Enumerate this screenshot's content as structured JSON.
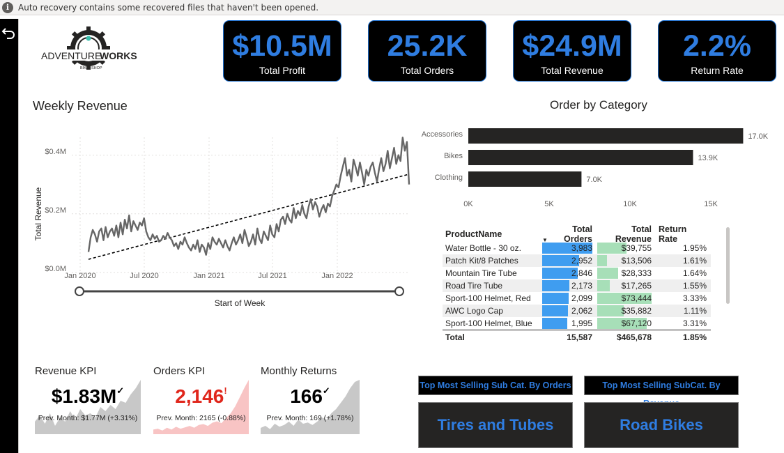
{
  "notice": "Auto recovery contains some recovered files that haven't been opened.",
  "logo": {
    "brand_a": "ADVENTURE",
    "brand_b": "WORKS",
    "ribbon_a": "BIKE",
    "ribbon_b": "SHOP"
  },
  "kpis": [
    {
      "value": "$10.5M",
      "label": "Total Profit"
    },
    {
      "value": "25.2K",
      "label": "Total Orders"
    },
    {
      "value": "$24.9M",
      "label": "Total Revenue"
    },
    {
      "value": "2.2%",
      "label": "Return Rate"
    }
  ],
  "weekly": {
    "title": "Weekly Revenue",
    "ylabel": "Total Revenue",
    "xlabel": "Start of Week",
    "yticks": [
      "$0.4M",
      "$0.2M",
      "$0.0M"
    ],
    "xticks": [
      "Jan 2020",
      "Jul 2020",
      "Jan 2021",
      "Jul 2021",
      "Jan 2022"
    ]
  },
  "category": {
    "title": "Order by Category",
    "xticks": [
      "0K",
      "5K",
      "10K",
      "15K"
    ]
  },
  "table": {
    "headers": [
      "ProductName",
      "Total Orders",
      "Total Revenue",
      "Return Rate"
    ],
    "rows": [
      {
        "name": "Water Bottle - 30 oz.",
        "orders": "3,983",
        "revenue": "$39,755",
        "rate": "1.95%"
      },
      {
        "name": "Patch Kit/8 Patches",
        "orders": "2,952",
        "revenue": "$13,506",
        "rate": "1.61%"
      },
      {
        "name": "Mountain Tire Tube",
        "orders": "2,846",
        "revenue": "$28,333",
        "rate": "1.64%"
      },
      {
        "name": "Road Tire Tube",
        "orders": "2,173",
        "revenue": "$17,265",
        "rate": "1.55%"
      },
      {
        "name": "Sport-100 Helmet, Red",
        "orders": "2,099",
        "revenue": "$73,444",
        "rate": "3.33%"
      },
      {
        "name": "AWC Logo Cap",
        "orders": "2,062",
        "revenue": "$35,882",
        "rate": "1.11%"
      },
      {
        "name": "Sport-100 Helmet, Blue",
        "orders": "1,995",
        "revenue": "$67,120",
        "rate": "3.31%"
      }
    ],
    "total": {
      "label": "Total",
      "orders": "15,587",
      "revenue": "$465,678",
      "rate": "1.85%"
    }
  },
  "mini_kpis": [
    {
      "title": "Revenue KPI",
      "value": "$1.83M",
      "mark": "✓",
      "sub": "Prev. Month: $1.77M (+3.31%)",
      "value_color": "#000000"
    },
    {
      "title": "Orders KPI",
      "value": "2,146",
      "mark": "!",
      "sub": "Prev. Month: 2165 (-0.88%)",
      "value_color": "#e0261b"
    },
    {
      "title": "Monthly Returns",
      "value": "166",
      "mark": "✓",
      "sub": "Prev. Month: 169 (+1.78%)",
      "value_color": "#000000"
    }
  ],
  "buttons": {
    "top_orders": "Top Most Selling Sub Cat. By Orders",
    "top_revenue": "Top Most Selling SubCat. By Revenue",
    "top_orders_value": "Tires and Tubes",
    "top_revenue_value": "Road Bikes"
  },
  "chart_data": [
    {
      "type": "line",
      "title": "Weekly Revenue",
      "xlabel": "Start of Week",
      "ylabel": "Total Revenue",
      "x_range": [
        "2020-01-01",
        "2022-06-30"
      ],
      "ylim": [
        0,
        450000
      ],
      "x_ticks": [
        "Jan 2020",
        "Jul 2020",
        "Jan 2021",
        "Jul 2021",
        "Jan 2022"
      ],
      "trend_line": {
        "start": 45000,
        "end": 335000
      },
      "series": [
        {
          "values": [
            70000,
            120000,
            145000,
            130000,
            105000,
            140000,
            150000,
            110000,
            155000,
            120000,
            140000,
            150000,
            125000,
            160000,
            120000,
            170000,
            130000,
            180000,
            150000,
            195000,
            140000,
            175000,
            160000,
            145000,
            170000,
            160000,
            185000,
            140000,
            120000,
            110000,
            130000,
            115000,
            125000,
            105000,
            110000,
            125000,
            115000,
            135000,
            120000,
            110000,
            90000,
            100000,
            80000,
            105000,
            95000,
            120000,
            100000,
            85000,
            75000,
            95000,
            80000,
            110000,
            70000,
            95000,
            85000,
            60000,
            100000,
            80000,
            120000,
            105000,
            95000,
            115000,
            100000,
            85000,
            110000,
            90000,
            75000,
            100000,
            120000,
            95000,
            110000,
            130000,
            100000,
            145000,
            120000,
            90000,
            105000,
            130000,
            95000,
            150000,
            115000,
            100000,
            140000,
            125000,
            110000,
            160000,
            130000,
            120000,
            165000,
            140000,
            180000,
            190000,
            165000,
            200000,
            180000,
            170000,
            220000,
            185000,
            210000,
            195000,
            230000,
            200000,
            185000,
            225000,
            250000,
            215000,
            240000,
            225000,
            190000,
            215000,
            230000,
            205000,
            235000,
            225000,
            260000,
            280000,
            300000,
            290000,
            330000,
            360000,
            390000,
            330000,
            350000,
            310000,
            385000,
            360000,
            330000,
            375000,
            340000,
            300000,
            350000,
            330000,
            360000,
            375000,
            340000,
            310000,
            355000,
            390000,
            345000,
            370000,
            415000,
            355000,
            390000,
            425000,
            370000,
            400000,
            380000,
            460000,
            415000,
            445000,
            300000
          ]
        }
      ]
    },
    {
      "type": "bar",
      "orientation": "horizontal",
      "title": "Order by Category",
      "categories": [
        "Accessories",
        "Bikes",
        "Clothing"
      ],
      "values": [
        17000,
        13900,
        7000
      ],
      "data_labels": [
        "17.0K",
        "13.9K",
        "7.0K"
      ],
      "xlim": [
        0,
        15000
      ],
      "x_ticks": [
        "0K",
        "5K",
        "10K",
        "15K"
      ]
    },
    {
      "type": "table",
      "columns": [
        "ProductName",
        "Total Orders",
        "Total Revenue",
        "Return Rate"
      ],
      "orders_numeric": [
        3983,
        2952,
        2846,
        2173,
        2099,
        2062,
        1995
      ],
      "revenue_numeric": [
        39755,
        13506,
        28333,
        17265,
        73444,
        35882,
        67120
      ]
    },
    {
      "type": "area",
      "name_ref": "Revenue KPI",
      "values": [
        30,
        45,
        25,
        50,
        20,
        40,
        30,
        55,
        35,
        60,
        45,
        50,
        40,
        65,
        55,
        70,
        60,
        80,
        75,
        95,
        110,
        130
      ]
    },
    {
      "type": "area",
      "name_ref": "Orders KPI",
      "values": [
        10,
        12,
        8,
        14,
        10,
        16,
        12,
        15,
        18,
        14,
        20,
        22,
        18,
        25,
        28,
        24,
        35,
        45,
        60,
        80,
        100,
        118
      ]
    },
    {
      "type": "area",
      "name_ref": "Monthly Returns",
      "values": [
        15,
        20,
        12,
        25,
        18,
        22,
        30,
        20,
        35,
        25,
        28,
        22,
        30,
        40,
        35,
        50,
        60,
        75,
        90,
        110,
        125,
        130
      ]
    }
  ]
}
